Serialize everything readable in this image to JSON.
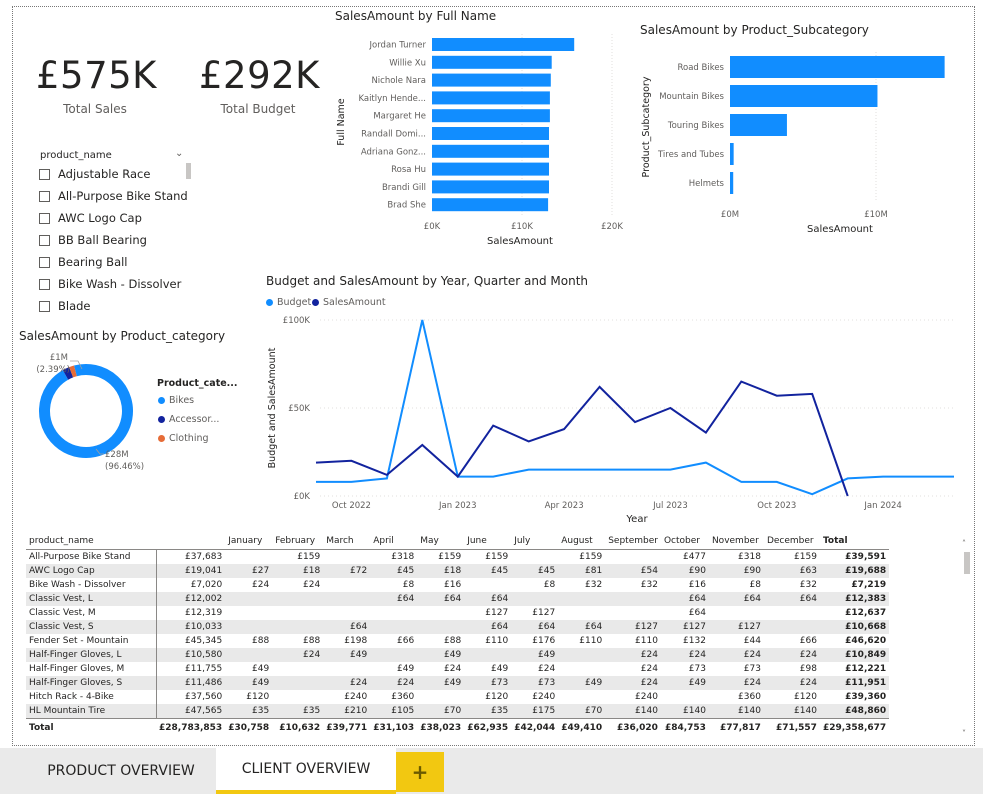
{
  "kpis": [
    {
      "value": "£575K",
      "label": "Total Sales"
    },
    {
      "value": "£292K",
      "label": "Total Budget"
    }
  ],
  "slicer": {
    "title": "product_name",
    "items": [
      "Adjustable Race",
      "All-Purpose Bike Stand",
      "AWC Logo Cap",
      "BB Ball Bearing",
      "Bearing Ball",
      "Bike Wash - Dissolver",
      "Blade"
    ]
  },
  "chart_data": [
    {
      "type": "bar",
      "orientation": "horizontal",
      "title": "SalesAmount by Full Name",
      "xlabel": "SalesAmount",
      "ylabel": "Full Name",
      "categories": [
        "Jordan Turner",
        "Willie Xu",
        "Nichole Nara",
        "Kaitlyn Hende...",
        "Margaret He",
        "Randall Domi...",
        "Adriana Gonz...",
        "Rosa Hu",
        "Brandi Gill",
        "Brad She"
      ],
      "values": [
        15800,
        13300,
        13200,
        13100,
        13100,
        13000,
        13000,
        13000,
        13000,
        12900
      ],
      "xticks": [
        "£0K",
        "£10K",
        "£20K"
      ],
      "xlim": [
        0,
        20000
      ],
      "color": "#118DFF"
    },
    {
      "type": "bar",
      "orientation": "horizontal",
      "title": "SalesAmount by Product_Subcategory",
      "xlabel": "SalesAmount",
      "ylabel": "Product_Subcategory",
      "categories": [
        "Road Bikes",
        "Mountain Bikes",
        "Touring Bikes",
        "Tires and Tubes",
        "Helmets"
      ],
      "values": [
        14700000,
        10100000,
        3900000,
        250000,
        220000
      ],
      "xticks": [
        "£0M",
        "£10M"
      ],
      "xlim": [
        0,
        15000000
      ],
      "color": "#118DFF"
    },
    {
      "type": "line",
      "title": "Budget and SalesAmount by Year, Quarter and Month",
      "xlabel": "Year",
      "ylabel": "Budget and SalesAmount",
      "x": [
        "Sep 2022",
        "Oct 2022",
        "Nov 2022",
        "Dec 2022",
        "Jan 2023",
        "Feb 2023",
        "Mar 2023",
        "Apr 2023",
        "May 2023",
        "Jun 2023",
        "Jul 2023",
        "Aug 2023",
        "Sep 2023",
        "Oct 2023",
        "Nov 2023",
        "Dec 2023",
        "Jan 2024",
        "Feb 2024",
        "Mar 2024"
      ],
      "xticks": [
        "Oct 2022",
        "Jan 2023",
        "Apr 2023",
        "Jul 2023",
        "Oct 2023",
        "Jan 2024"
      ],
      "yticks": [
        "£0K",
        "£50K",
        "£100K"
      ],
      "ylim": [
        0,
        100000
      ],
      "series": [
        {
          "name": "Budget",
          "color": "#118DFF",
          "values": [
            8000,
            8000,
            10000,
            100000,
            11000,
            11000,
            15000,
            15000,
            15000,
            15000,
            15000,
            19000,
            8000,
            8000,
            1000,
            10000,
            11000,
            11000,
            11000
          ]
        },
        {
          "name": "SalesAmount",
          "color": "#12239E",
          "values": [
            19000,
            20000,
            12000,
            29000,
            11000,
            40000,
            31000,
            38000,
            62000,
            42000,
            50000,
            36000,
            65000,
            57000,
            58000,
            0,
            null,
            null,
            null
          ]
        }
      ]
    },
    {
      "type": "pie",
      "subtype": "donut",
      "title": "SalesAmount by Product_category",
      "legend_title": "Product_cate...",
      "categories": [
        "Bikes",
        "Accessor...",
        "Clothing"
      ],
      "values": [
        28,
        0.7,
        0.5
      ],
      "colors": [
        "#118DFF",
        "#12239E",
        "#E66C37"
      ],
      "labels": [
        {
          "value": "£28M",
          "pct": "(96.46%)"
        },
        {
          "value": "£1M",
          "pct": "(2.39%)"
        }
      ]
    }
  ],
  "table": {
    "headers": [
      "product_name",
      "January",
      "February",
      "March",
      "April",
      "May",
      "June",
      "July",
      "August",
      "September",
      "October",
      "November",
      "December",
      "Total"
    ],
    "rows": [
      [
        "All-Purpose Bike Stand",
        "£37,683",
        "",
        "£159",
        "",
        "£318",
        "£159",
        "£159",
        "",
        "£159",
        "",
        "£477",
        "£318",
        "£159",
        "£39,591"
      ],
      [
        "AWC Logo Cap",
        "£19,041",
        "£27",
        "£18",
        "£72",
        "£45",
        "£18",
        "£45",
        "£45",
        "£81",
        "£54",
        "£90",
        "£90",
        "£63",
        "£19,688"
      ],
      [
        "Bike Wash - Dissolver",
        "£7,020",
        "£24",
        "£24",
        "",
        "£8",
        "£16",
        "",
        "£8",
        "£32",
        "£32",
        "£16",
        "£8",
        "£32",
        "£7,219"
      ],
      [
        "Classic Vest, L",
        "£12,002",
        "",
        "",
        "",
        "£64",
        "£64",
        "£64",
        "",
        "",
        "",
        "£64",
        "£64",
        "£64",
        "£12,383"
      ],
      [
        "Classic Vest, M",
        "£12,319",
        "",
        "",
        "",
        "",
        "",
        "£127",
        "£127",
        "",
        "",
        "£64",
        "",
        "",
        "£12,637"
      ],
      [
        "Classic Vest, S",
        "£10,033",
        "",
        "",
        "£64",
        "",
        "",
        "£64",
        "£64",
        "£64",
        "£127",
        "£127",
        "£127",
        "",
        "£10,668"
      ],
      [
        "Fender Set - Mountain",
        "£45,345",
        "£88",
        "£88",
        "£198",
        "£66",
        "£88",
        "£110",
        "£176",
        "£110",
        "£110",
        "£132",
        "£44",
        "£66",
        "£46,620"
      ],
      [
        "Half-Finger Gloves, L",
        "£10,580",
        "",
        "£24",
        "£49",
        "",
        "£49",
        "",
        "£49",
        "",
        "£24",
        "£24",
        "£24",
        "£24",
        "£10,849"
      ],
      [
        "Half-Finger Gloves, M",
        "£11,755",
        "£49",
        "",
        "",
        "£49",
        "£24",
        "£49",
        "£24",
        "",
        "£24",
        "£73",
        "£73",
        "£98",
        "£12,221"
      ],
      [
        "Half-Finger Gloves, S",
        "£11,486",
        "£49",
        "",
        "£24",
        "£24",
        "£49",
        "£73",
        "£73",
        "£49",
        "£24",
        "£49",
        "£24",
        "£24",
        "£11,951"
      ],
      [
        "Hitch Rack - 4-Bike",
        "£37,560",
        "£120",
        "",
        "£240",
        "£360",
        "",
        "£120",
        "£240",
        "",
        "£240",
        "",
        "£360",
        "£120",
        "£39,360"
      ],
      [
        "HL Mountain Tire",
        "£47,565",
        "£35",
        "£35",
        "£210",
        "£105",
        "£70",
        "£35",
        "£175",
        "£70",
        "£140",
        "£140",
        "£140",
        "£140",
        "£48,860"
      ]
    ],
    "total": [
      "Total",
      "£28,783,853",
      "£30,758",
      "£10,632",
      "£39,771",
      "£31,103",
      "£38,023",
      "£62,935",
      "£42,044",
      "£49,410",
      "£36,020",
      "£84,753",
      "£77,817",
      "£71,557",
      "£29,358,677"
    ]
  },
  "tabs": [
    {
      "label": "PRODUCT OVERVIEW",
      "active": false
    },
    {
      "label": "CLIENT OVERVIEW",
      "active": true
    },
    {
      "label": "+",
      "active": false
    }
  ]
}
